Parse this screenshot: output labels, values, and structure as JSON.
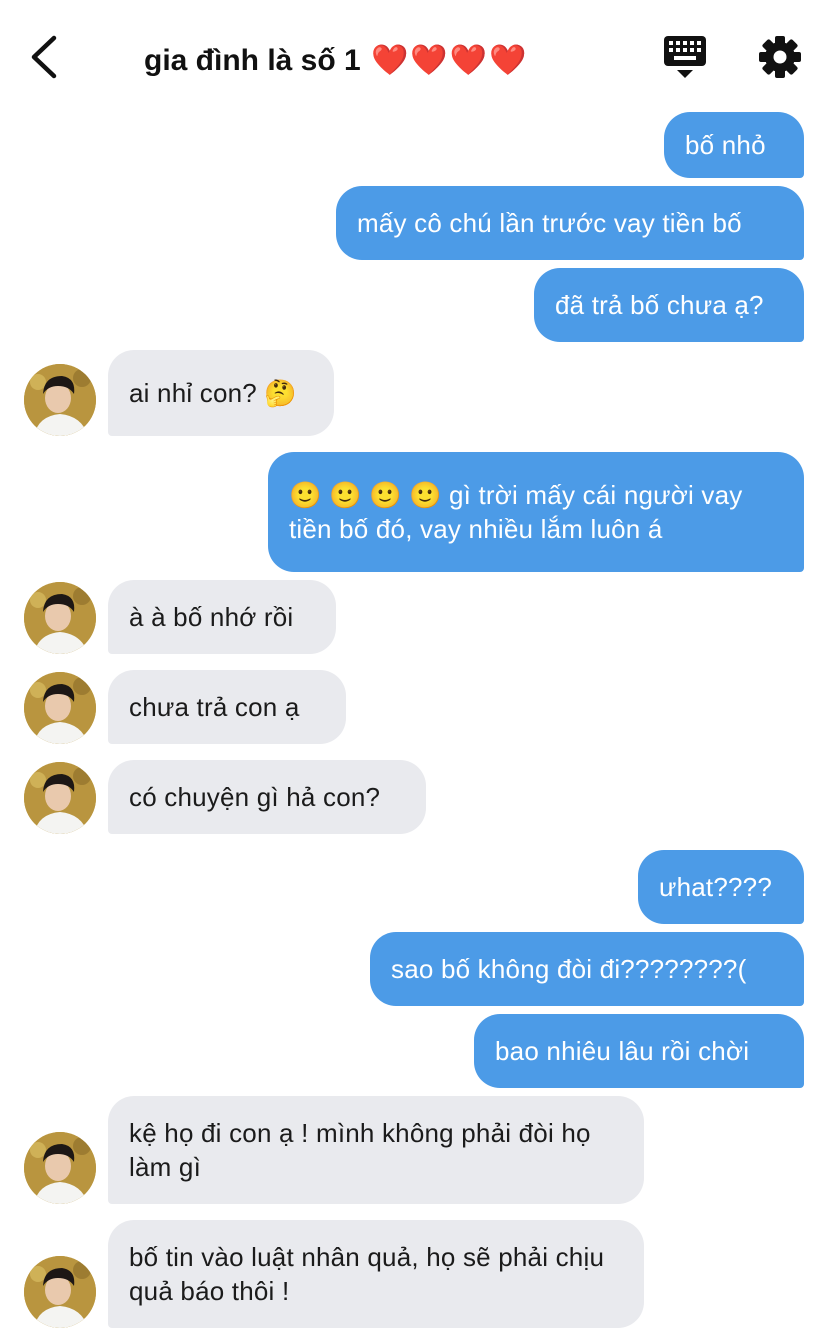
{
  "header": {
    "title": "gia đình là số 1",
    "title_hearts": "❤️❤️❤️❤️"
  },
  "messages": [
    {
      "side": "sent",
      "text": "bố nhỏ"
    },
    {
      "side": "sent",
      "text": "mấy cô chú lần trước vay tiền bố"
    },
    {
      "side": "sent",
      "text": "đã trả bố chưa ạ?"
    },
    {
      "side": "recv",
      "text": "ai nhỉ con? 🤔"
    },
    {
      "side": "sent",
      "text": "🙂 🙂 🙂 🙂  gì trời mấy cái người vay tiền bố đó, vay nhiều lắm luôn á"
    },
    {
      "side": "recv",
      "text": "à à bố nhớ rồi"
    },
    {
      "side": "recv",
      "text": "chưa trả con ạ"
    },
    {
      "side": "recv",
      "text": "có chuyện gì hả con?"
    },
    {
      "side": "sent",
      "text": "ưhat????"
    },
    {
      "side": "sent",
      "text": "sao bố không đòi đi????????("
    },
    {
      "side": "sent",
      "text": "bao nhiêu lâu rồi chời"
    },
    {
      "side": "recv",
      "text": "kệ họ đi con ạ ! mình không phải đòi họ làm gì"
    },
    {
      "side": "recv",
      "text": "bố tin vào luật nhân quả, họ sẽ phải chịu quả báo thôi !"
    }
  ],
  "colors": {
    "sent_bubble": "#4c9be7",
    "recv_bubble": "#e9eaee",
    "heart": "#e0262a"
  },
  "icons": {
    "back": "chevron-left-icon",
    "keyboard": "keyboard-icon",
    "settings": "gear-icon",
    "avatar": "avatar-photo"
  }
}
